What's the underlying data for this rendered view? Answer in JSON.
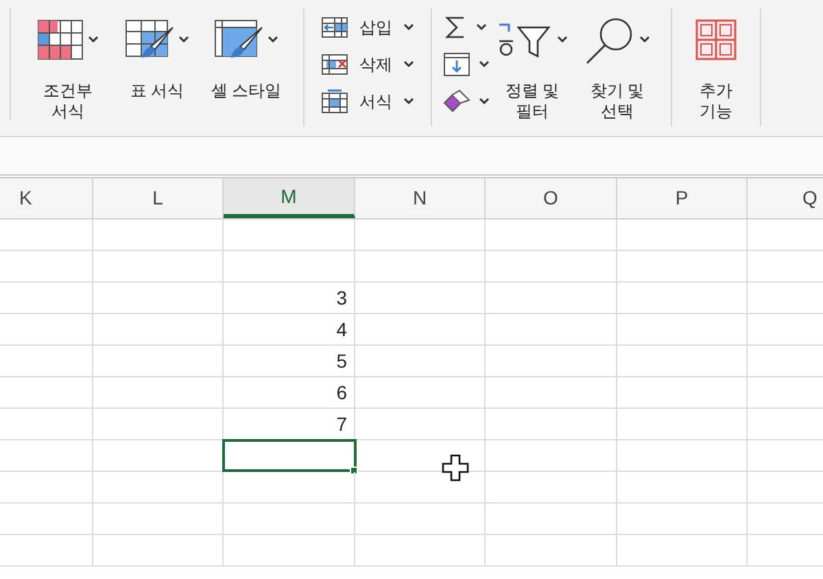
{
  "ribbon": {
    "style_buttons": [
      {
        "kind": "conditional",
        "label": "조건부\n서식"
      },
      {
        "kind": "table",
        "label": "표 서식"
      },
      {
        "kind": "cellstyle",
        "label": "셀 스타일"
      }
    ],
    "cell_buttons": [
      {
        "kind": "insert",
        "label": "삽입"
      },
      {
        "kind": "delete",
        "label": "삭제"
      },
      {
        "kind": "format",
        "label": "서식"
      }
    ],
    "edit_small": [
      {
        "kind": "sum"
      },
      {
        "kind": "fill"
      },
      {
        "kind": "clear"
      }
    ],
    "edit_buttons": [
      {
        "kind": "sort",
        "label": "정렬 및\n필터"
      },
      {
        "kind": "find",
        "label": "찾기 및\n선택"
      }
    ],
    "addin_button": {
      "label": "추가\n기능"
    }
  },
  "columns": [
    {
      "label": "K",
      "selected": false
    },
    {
      "label": "L",
      "selected": false
    },
    {
      "label": "M",
      "selected": true
    },
    {
      "label": "N",
      "selected": false
    },
    {
      "label": "O",
      "selected": false
    },
    {
      "label": "P",
      "selected": false
    },
    {
      "label": "Q",
      "selected": false
    }
  ],
  "rows": [
    {
      "selected": false
    },
    {
      "selected": false
    },
    {
      "selected": false,
      "value": "3"
    },
    {
      "selected": false,
      "value": "4"
    },
    {
      "selected": false,
      "value": "5"
    },
    {
      "selected": false,
      "value": "6"
    },
    {
      "selected": false,
      "value": "7"
    },
    {
      "selected": true
    },
    {
      "selected": false
    },
    {
      "selected": false
    },
    {
      "selected": false
    }
  ]
}
